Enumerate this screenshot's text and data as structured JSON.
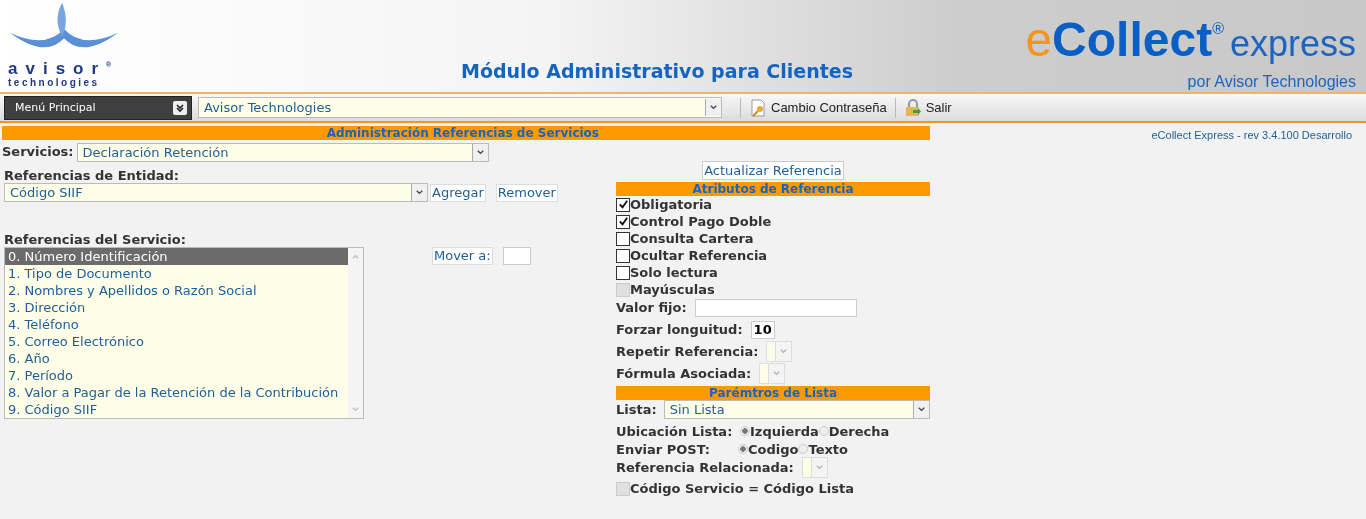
{
  "header": {
    "logo_left": {
      "brand": "avisor",
      "mark": "®",
      "tagline": "technologies"
    },
    "title": "Módulo Administrativo para Clientes",
    "logo_right": {
      "e": "e",
      "collect": "Collect",
      "mark": "®",
      "express": "express",
      "by": "por Avisor Technologies"
    }
  },
  "toolbar": {
    "menu": "Menú Principal",
    "company": "Avisor Technologies",
    "buttons": [
      {
        "label": "Cambio Contraseña",
        "kind": "key"
      },
      {
        "label": "Salir",
        "kind": "exit"
      }
    ]
  },
  "version": "eCollect Express - rev 3.4.100 Desarrollo",
  "section_title": "Administración Referencias de Servicios",
  "servicios": {
    "label": "Servicios:",
    "value": "Declaración Retención"
  },
  "entidad": {
    "label": "Referencias de Entidad:",
    "value": "Código SIIF",
    "buttons": [
      "Agregar",
      "Remover"
    ]
  },
  "servicio_refs": {
    "label": "Referencias del Servicio:",
    "items": [
      {
        "text": "0. Número Identificación",
        "selected": true
      },
      {
        "text": "1. Tipo de Documento",
        "selected": false
      },
      {
        "text": "2. Nombres y Apellidos o Razón Social",
        "selected": false
      },
      {
        "text": "3. Dirección",
        "selected": false
      },
      {
        "text": "4. Teléfono",
        "selected": false
      },
      {
        "text": "5. Correo Electrónico",
        "selected": false
      },
      {
        "text": "6. Año",
        "selected": false
      },
      {
        "text": "7. Período",
        "selected": false
      },
      {
        "text": "8. Valor a Pagar de la Retención de la Contribución",
        "selected": false
      },
      {
        "text": "9. Código SIIF",
        "selected": false
      }
    ]
  },
  "move": {
    "label": "Mover a:"
  },
  "right_panel": [
    {
      "kind": "button",
      "label": "Actualizar Referencia"
    },
    {
      "kind": "section",
      "label": "Atributos de Referencia"
    },
    {
      "kind": "checkbox",
      "label": "Obligatoria",
      "checked": true,
      "disabled": false
    },
    {
      "kind": "checkbox",
      "label": "Control Pago Doble",
      "checked": true,
      "disabled": false
    },
    {
      "kind": "checkbox",
      "label": "Consulta Cartera",
      "checked": false,
      "disabled": false
    },
    {
      "kind": "checkbox",
      "label": "Ocultar Referencia",
      "checked": false,
      "disabled": false
    },
    {
      "kind": "checkbox",
      "label": "Solo lectura",
      "checked": false,
      "disabled": false
    },
    {
      "kind": "checkbox",
      "label": "Mayúsculas",
      "checked": false,
      "disabled": true
    },
    {
      "kind": "text",
      "label": "Valor fijo:",
      "wide": true
    },
    {
      "kind": "text",
      "label": "Forzar longuitud:",
      "value": "10",
      "wide": false
    },
    {
      "kind": "small_select",
      "label": "Repetir Referencia:"
    },
    {
      "kind": "small_select",
      "label": "Fórmula Asociada:"
    },
    {
      "kind": "section",
      "label": "Parémtros de Lista"
    },
    {
      "kind": "select",
      "label": "Lista:",
      "value": "Sin Lista"
    },
    {
      "kind": "radio",
      "label": "Ubicación Lista:",
      "options": [
        {
          "label": "Izquierda",
          "selected": true
        },
        {
          "label": "Derecha",
          "selected": false
        }
      ]
    },
    {
      "kind": "radio",
      "label": "Enviar POST:",
      "options": [
        {
          "label": "Codigo",
          "selected": true
        },
        {
          "label": "Texto",
          "selected": false
        }
      ]
    },
    {
      "kind": "small_select",
      "label": "Referencia Relacionada:"
    },
    {
      "kind": "checkbox",
      "label": "Código Servicio = Código Lista",
      "checked": false,
      "disabled": true
    }
  ]
}
